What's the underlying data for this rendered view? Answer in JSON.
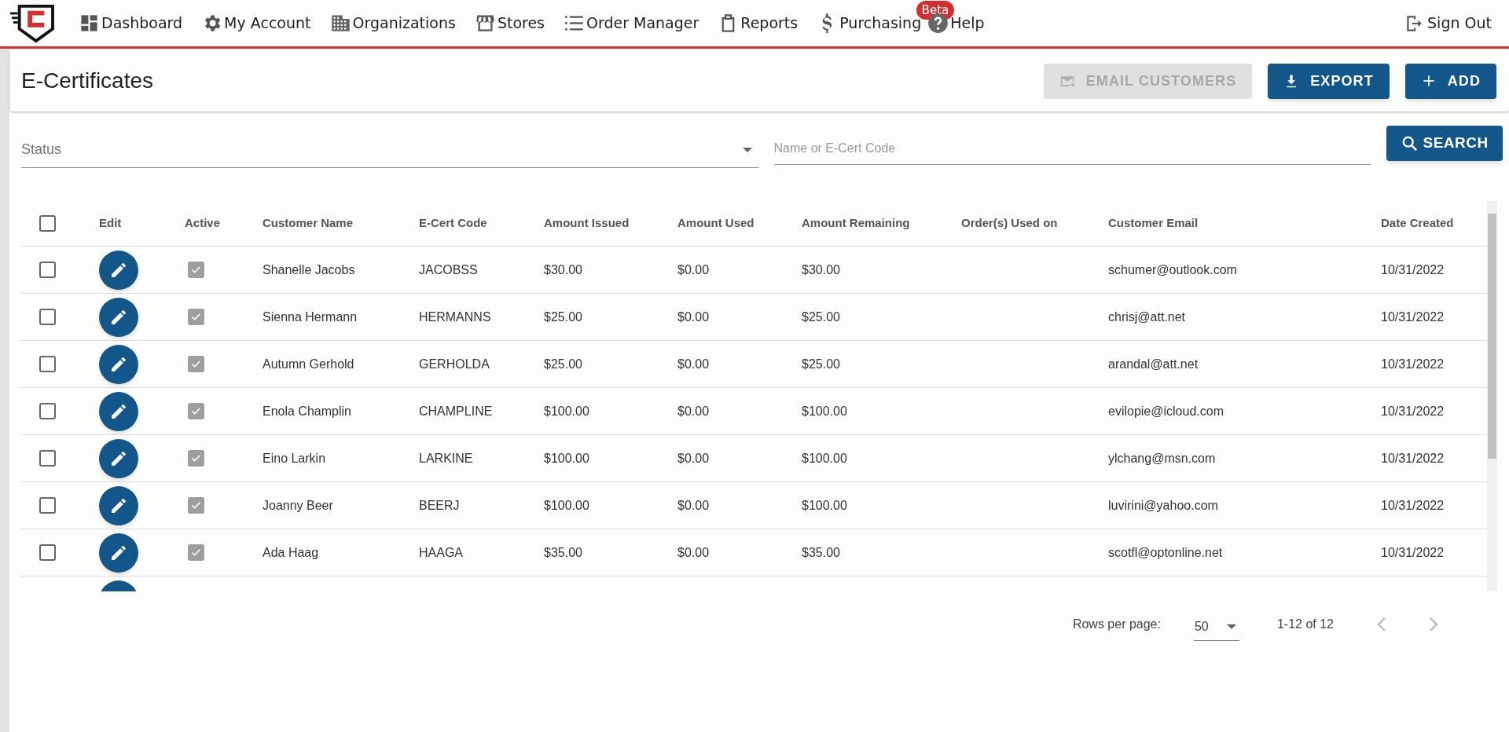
{
  "nav": {
    "items": [
      {
        "label": "Dashboard"
      },
      {
        "label": "My Account"
      },
      {
        "label": "Organizations"
      },
      {
        "label": "Stores"
      },
      {
        "label": "Order Manager"
      },
      {
        "label": "Reports"
      },
      {
        "label": "Purchasing",
        "badge": "Beta"
      },
      {
        "label": "Help"
      }
    ],
    "sign_out": "Sign Out"
  },
  "page": {
    "title": "E-Certificates",
    "actions": [
      {
        "label": "EMAIL CUSTOMERS",
        "disabled": true
      },
      {
        "label": "EXPORT",
        "disabled": false
      },
      {
        "label": "ADD",
        "disabled": false
      }
    ]
  },
  "filters": {
    "status": {
      "placeholder": "Status"
    },
    "search": {
      "placeholder": "Name or E-Cert Code"
    },
    "search_button": "SEARCH"
  },
  "table": {
    "all_selected": false,
    "columns": [
      "Edit",
      "Active",
      "Customer Name",
      "E-Cert Code",
      "Amount Issued",
      "Amount Used",
      "Amount Remaining",
      "Order(s) Used on",
      "Customer Email",
      "Date Created"
    ],
    "rows": [
      {
        "selected": false,
        "active": true,
        "cells": [
          "",
          "",
          "Shanelle Jacobs",
          "JACOBSS",
          "$30.00",
          "$0.00",
          "$30.00",
          "",
          "schumer@outlook.com",
          "10/31/2022"
        ]
      },
      {
        "selected": false,
        "active": true,
        "cells": [
          "",
          "",
          "Sienna Hermann",
          "HERMANNS",
          "$25.00",
          "$0.00",
          "$25.00",
          "",
          "chrisj@att.net",
          "10/31/2022"
        ]
      },
      {
        "selected": false,
        "active": true,
        "cells": [
          "",
          "",
          "Autumn Gerhold",
          "GERHOLDA",
          "$25.00",
          "$0.00",
          "$25.00",
          "",
          "arandal@att.net",
          "10/31/2022"
        ]
      },
      {
        "selected": false,
        "active": true,
        "cells": [
          "",
          "",
          "Enola Champlin",
          "CHAMPLINE",
          "$100.00",
          "$0.00",
          "$100.00",
          "",
          "evilopie@icloud.com",
          "10/31/2022"
        ]
      },
      {
        "selected": false,
        "active": true,
        "cells": [
          "",
          "",
          "Eino Larkin",
          "LARKINE",
          "$100.00",
          "$0.00",
          "$100.00",
          "",
          "ylchang@msn.com",
          "10/31/2022"
        ]
      },
      {
        "selected": false,
        "active": true,
        "cells": [
          "",
          "",
          "Joanny Beer",
          "BEERJ",
          "$100.00",
          "$0.00",
          "$100.00",
          "",
          "luvirini@yahoo.com",
          "10/31/2022"
        ]
      },
      {
        "selected": false,
        "active": true,
        "cells": [
          "",
          "",
          "Ada Haag",
          "HAAGA",
          "$35.00",
          "$0.00",
          "$35.00",
          "",
          "scotfl@optonline.net",
          "10/31/2022"
        ]
      }
    ]
  },
  "pagination": {
    "rows_per_page_label": "Rows per page:",
    "rows_per_page": "50",
    "range": "1-12 of 12"
  }
}
